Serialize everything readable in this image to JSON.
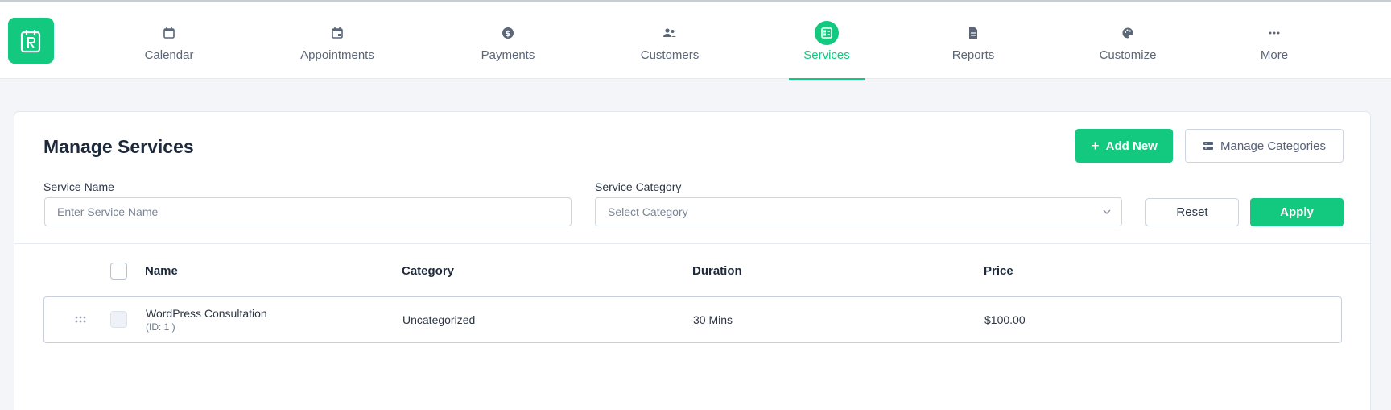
{
  "nav": {
    "items": [
      {
        "label": "Calendar",
        "icon": "calendar-icon"
      },
      {
        "label": "Appointments",
        "icon": "appointment-calendar-icon"
      },
      {
        "label": "Payments",
        "icon": "dollar-circle-icon"
      },
      {
        "label": "Customers",
        "icon": "users-icon"
      },
      {
        "label": "Services",
        "icon": "services-icon",
        "active": true
      },
      {
        "label": "Reports",
        "icon": "report-file-icon"
      },
      {
        "label": "Customize",
        "icon": "palette-icon"
      },
      {
        "label": "More",
        "icon": "more-dots-icon"
      }
    ]
  },
  "colors": {
    "accent": "#12c97f",
    "text": "#1e2a3b",
    "muted": "#5b6678"
  },
  "main": {
    "title": "Manage Services",
    "add_new_label": "Add New",
    "manage_categories_label": "Manage Categories",
    "filters": {
      "service_name_label": "Service Name",
      "service_name_placeholder": "Enter Service Name",
      "service_category_label": "Service Category",
      "service_category_placeholder": "Select Category",
      "reset_label": "Reset",
      "apply_label": "Apply"
    },
    "table": {
      "headers": [
        "Name",
        "Category",
        "Duration",
        "Price"
      ],
      "rows": [
        {
          "name": "WordPress Consultation",
          "id_text": "(ID: 1 )",
          "category": "Uncategorized",
          "duration": "30 Mins",
          "price": "$100.00"
        }
      ]
    }
  }
}
